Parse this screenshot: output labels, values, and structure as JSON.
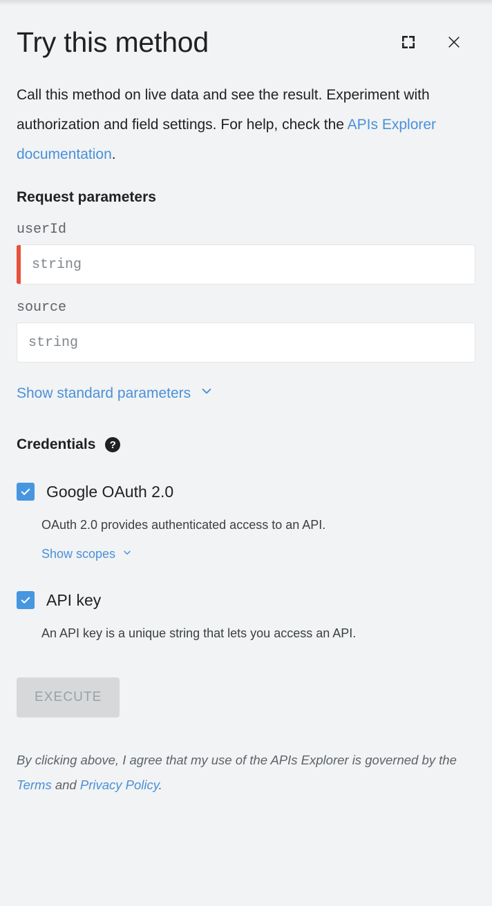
{
  "header": {
    "title": "Try this method",
    "fullscreen_icon": "fullscreen-icon",
    "close_icon": "close-icon"
  },
  "description": {
    "line1": "Call this method on live data and see the result.",
    "line2": "Experiment with authorization and field settings.",
    "line3_prefix": "For help, check the ",
    "link_label": "APIs Explorer documentation",
    "line3_suffix": "."
  },
  "request_parameters": {
    "heading": "Request parameters",
    "fields": [
      {
        "name": "userId",
        "placeholder": "string",
        "value": "",
        "required": true
      },
      {
        "name": "source",
        "placeholder": "string",
        "value": "",
        "required": false
      }
    ],
    "show_standard_label": "Show standard parameters",
    "chevron_icon": "chevron-down-icon"
  },
  "credentials": {
    "heading": "Credentials",
    "help_icon": "help-icon",
    "items": [
      {
        "label": "Google OAuth 2.0",
        "checked": true,
        "description": "OAuth 2.0 provides authenticated access to an API.",
        "show_scopes_label": "Show scopes",
        "has_scopes": true
      },
      {
        "label": "API key",
        "checked": true,
        "description": "An API key is a unique string that lets you access an API.",
        "show_scopes_label": "",
        "has_scopes": false
      }
    ]
  },
  "execute": {
    "label": "EXECUTE",
    "disabled": true
  },
  "footer": {
    "prefix": "By clicking above, I agree that my use of the APIs Explorer is governed by the ",
    "terms_label": "Terms",
    "middle": " and ",
    "privacy_label": "Privacy Policy",
    "suffix": "."
  },
  "colors": {
    "background": "#f1f3f4",
    "link": "#4a90d9",
    "checkbox": "#4696e0",
    "required_bar": "#e8503a",
    "text": "#202124",
    "muted_text": "#5f6368",
    "button_disabled_bg": "#d6d8da",
    "button_disabled_text": "#9aa0a6"
  }
}
